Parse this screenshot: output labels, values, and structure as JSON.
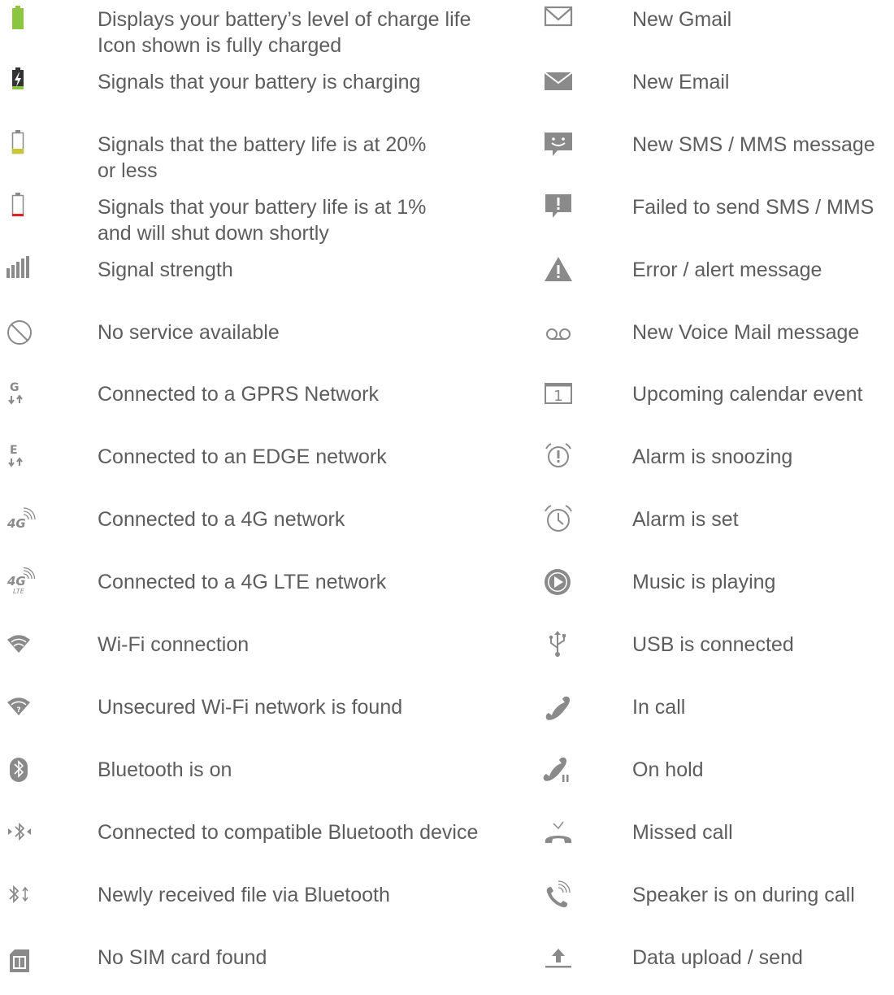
{
  "left": [
    {
      "icon": "battery-full-icon",
      "lines": [
        "Displays your battery’s level of charge life",
        "Icon shown is fully charged"
      ]
    },
    {
      "icon": "battery-charging-icon",
      "lines": [
        "Signals that your battery is charging"
      ]
    },
    {
      "icon": "battery-low-icon",
      "lines": [
        "Signals that the battery life is at 20%",
        "or less"
      ]
    },
    {
      "icon": "battery-critical-icon",
      "lines": [
        "Signals that your battery life is at 1%",
        "and will shut down shortly"
      ]
    },
    {
      "icon": "signal-strength-icon",
      "lines": [
        "Signal strength"
      ]
    },
    {
      "icon": "no-service-icon",
      "lines": [
        "No service available"
      ]
    },
    {
      "icon": "gprs-icon",
      "lines": [
        "Connected to a GPRS Network"
      ]
    },
    {
      "icon": "edge-icon",
      "lines": [
        "Connected to an EDGE network"
      ]
    },
    {
      "icon": "4g-icon",
      "lines": [
        "Connected to a 4G network"
      ]
    },
    {
      "icon": "4g-lte-icon",
      "lines": [
        "Connected to a 4G LTE network"
      ]
    },
    {
      "icon": "wifi-icon",
      "lines": [
        "Wi-Fi connection"
      ]
    },
    {
      "icon": "wifi-unsecured-icon",
      "lines": [
        "Unsecured Wi-Fi network is found"
      ]
    },
    {
      "icon": "bluetooth-on-icon",
      "lines": [
        "Bluetooth is on"
      ]
    },
    {
      "icon": "bluetooth-connected-icon",
      "lines": [
        "Connected to compatible Bluetooth device"
      ]
    },
    {
      "icon": "bluetooth-file-icon",
      "lines": [
        "Newly received file via Bluetooth"
      ]
    },
    {
      "icon": "no-sim-icon",
      "lines": [
        "No SIM card found"
      ]
    }
  ],
  "right": [
    {
      "icon": "gmail-icon",
      "lines": [
        "New Gmail"
      ]
    },
    {
      "icon": "email-icon",
      "lines": [
        "New Email"
      ]
    },
    {
      "icon": "sms-icon",
      "lines": [
        "New SMS / MMS message"
      ]
    },
    {
      "icon": "sms-failed-icon",
      "lines": [
        "Failed to send SMS / MMS"
      ]
    },
    {
      "icon": "alert-icon",
      "lines": [
        "Error / alert message"
      ]
    },
    {
      "icon": "voicemail-icon",
      "lines": [
        "New Voice Mail message"
      ]
    },
    {
      "icon": "calendar-icon",
      "lines": [
        "Upcoming calendar event"
      ],
      "icon_text": "1"
    },
    {
      "icon": "alarm-snooze-icon",
      "lines": [
        "Alarm is snoozing"
      ]
    },
    {
      "icon": "alarm-set-icon",
      "lines": [
        "Alarm is set"
      ]
    },
    {
      "icon": "music-playing-icon",
      "lines": [
        "Music is playing"
      ]
    },
    {
      "icon": "usb-icon",
      "lines": [
        "USB is connected"
      ]
    },
    {
      "icon": "in-call-icon",
      "lines": [
        "In call"
      ]
    },
    {
      "icon": "on-hold-icon",
      "lines": [
        "On hold"
      ]
    },
    {
      "icon": "missed-call-icon",
      "lines": [
        "Missed call"
      ]
    },
    {
      "icon": "speakerphone-icon",
      "lines": [
        "Speaker is on during call"
      ]
    },
    {
      "icon": "upload-icon",
      "lines": [
        "Data upload / send"
      ]
    }
  ],
  "colors": {
    "text": "#5d5d5d",
    "icon": "#8a8a8a",
    "battery_green": "#8cc63f",
    "battery_yellow": "#c8c832",
    "battery_red": "#e02424"
  }
}
